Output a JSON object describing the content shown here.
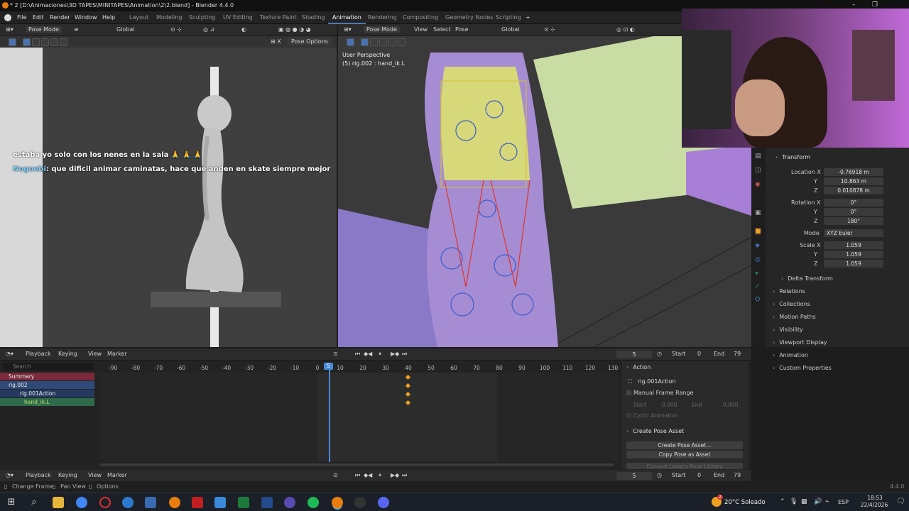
{
  "window": {
    "title": "* 2 [D:\\Animaciones\\3D TAPES\\MINITAPES\\Animation\\2\\2.blend] - Blender 4.4.0"
  },
  "menu": [
    "File",
    "Edit",
    "Render",
    "Window",
    "Help"
  ],
  "workspaces": [
    "Layout",
    "Modeling",
    "Sculpting",
    "UV Editing",
    "Texture Paint",
    "Shading",
    "Animation",
    "Rendering",
    "Compositing",
    "Geometry Nodes",
    "Scripting"
  ],
  "active_workspace": "Animation",
  "left_vp": {
    "mode": "Pose Mode",
    "orientation": "Global",
    "pose_options": "Pose Options"
  },
  "right_vp": {
    "mode": "Pose Mode",
    "menus": [
      "View",
      "Select",
      "Pose"
    ],
    "orientation": "Global",
    "perspective": "User Perspective",
    "selection": "(5) rig.002 : hand_ik.L"
  },
  "chat": {
    "line1": "estaba yo solo con los nenes en la sala",
    "line1_emoji": "🙏 🙏 🙏",
    "user2": "Noguebi",
    "line2": "que dificil animar caminatas, hace que anden en skate siempre mejor"
  },
  "props": {
    "transform_label": "Transform",
    "location": {
      "label": "Location X",
      "x": "-0.76918 m",
      "y": "10.863 m",
      "z": "0.010878 m"
    },
    "rotation": {
      "label": "Rotation X",
      "x": "0°",
      "y": "0°",
      "z": "180°"
    },
    "mode_label": "Mode",
    "mode_value": "XYZ Euler",
    "scale": {
      "label": "Scale X",
      "x": "1.059",
      "y": "1.059",
      "z": "1.059"
    },
    "y_label": "Y",
    "z_label": "Z",
    "sections": [
      "Delta Transform",
      "Relations",
      "Collections",
      "Motion Paths",
      "Visibility",
      "Viewport Display",
      "Animation",
      "Custom Properties"
    ]
  },
  "timeline": {
    "menus": [
      "Playback",
      "Keying",
      "View",
      "Marker"
    ],
    "current_frame": "5",
    "start_label": "Start",
    "start": "0",
    "end_label": "End",
    "end": "79",
    "search_placeholder": "Search",
    "ruler": [
      "-90",
      "-80",
      "-70",
      "-60",
      "-50",
      "-40",
      "-30",
      "-20",
      "-10",
      "0",
      "10",
      "20",
      "30",
      "40",
      "50",
      "60",
      "70",
      "80",
      "90",
      "100",
      "110",
      "120",
      "130"
    ],
    "channels": [
      "Summary",
      "rig.002",
      "rig.001Action",
      "hand_ik.L"
    ],
    "keyframe_frame": 40,
    "frame_marker": "5"
  },
  "action_panel": {
    "header": "Action",
    "action_name": "rig.001Action",
    "manual_range": "Manual Frame Range",
    "start_label": "Start",
    "start_val": "0.000",
    "end_label": "End",
    "end_val": "0.000",
    "cyclic": "Cyclic Animation",
    "pose_header": "Create Pose Asset",
    "create_btn": "Create Pose Asset...",
    "copy_btn": "Copy Pose as Asset",
    "convert_btn": "Convert Legacy Pose Library"
  },
  "bottom_timeline": {
    "menus": [
      "Playback",
      "Keying",
      "View",
      "Marker"
    ],
    "frame": "5",
    "start_label": "Start",
    "start": "0",
    "end_label": "End",
    "end": "79"
  },
  "status": {
    "left": "Change Frame",
    "mid": "Pan View",
    "right": "Options",
    "version": "4.4.0"
  },
  "taskbar": {
    "weather": "20°C Soleado",
    "lang": "ESP",
    "time": "18:53",
    "date": "22/4/2026",
    "notif": "2"
  },
  "colors": {
    "accent": "#4b78b8",
    "keyframe": "#f0a020",
    "playhead": "#4a8ad8",
    "channel_summary": "#7a2a3a",
    "channel_obj": "#2e4a78",
    "channel_bone": "#2f6b4a"
  }
}
